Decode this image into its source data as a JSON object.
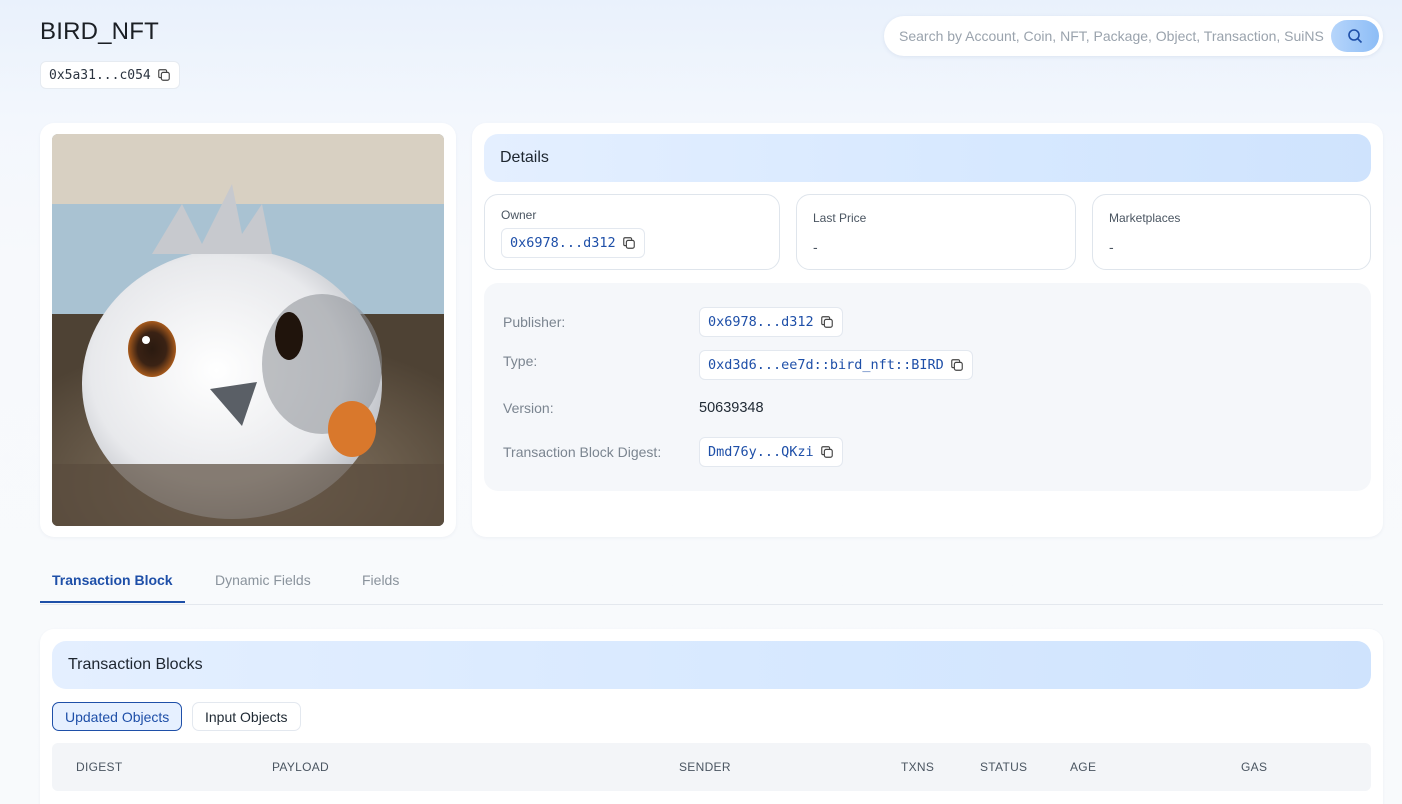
{
  "header": {
    "title": "BIRD_NFT",
    "object_address": "0x5a31...c054",
    "search_placeholder": "Search by Account, Coin, NFT, Package, Object, Transaction, SuiNS"
  },
  "details": {
    "heading": "Details",
    "owner": {
      "label": "Owner",
      "value": "0x6978...d312"
    },
    "last_price": {
      "label": "Last Price",
      "value": "-"
    },
    "marketplaces": {
      "label": "Marketplaces",
      "value": "-"
    },
    "properties": {
      "publisher": {
        "label": "Publisher:",
        "value": "0x6978...d312"
      },
      "type": {
        "label": "Type:",
        "value": "0xd3d6...ee7d::bird_nft::BIRD"
      },
      "version": {
        "label": "Version:",
        "value": "50639348"
      },
      "tx_digest": {
        "label": "Transaction Block Digest:",
        "value": "Dmd76y...QKzi"
      }
    }
  },
  "tabs": [
    {
      "label": "Transaction Block",
      "active": true
    },
    {
      "label": "Dynamic Fields",
      "active": false
    },
    {
      "label": "Fields",
      "active": false
    }
  ],
  "transactions": {
    "heading": "Transaction Blocks",
    "toggles": {
      "updated": "Updated Objects",
      "input": "Input Objects"
    },
    "columns": [
      "DIGEST",
      "PAYLOAD",
      "SENDER",
      "TXNS",
      "STATUS",
      "AGE",
      "GAS"
    ]
  },
  "colors": {
    "accent": "#1e4fa8",
    "header_gradient": "#d6e8ff"
  },
  "icons": {
    "copy": "copy-icon",
    "search": "search-icon"
  }
}
